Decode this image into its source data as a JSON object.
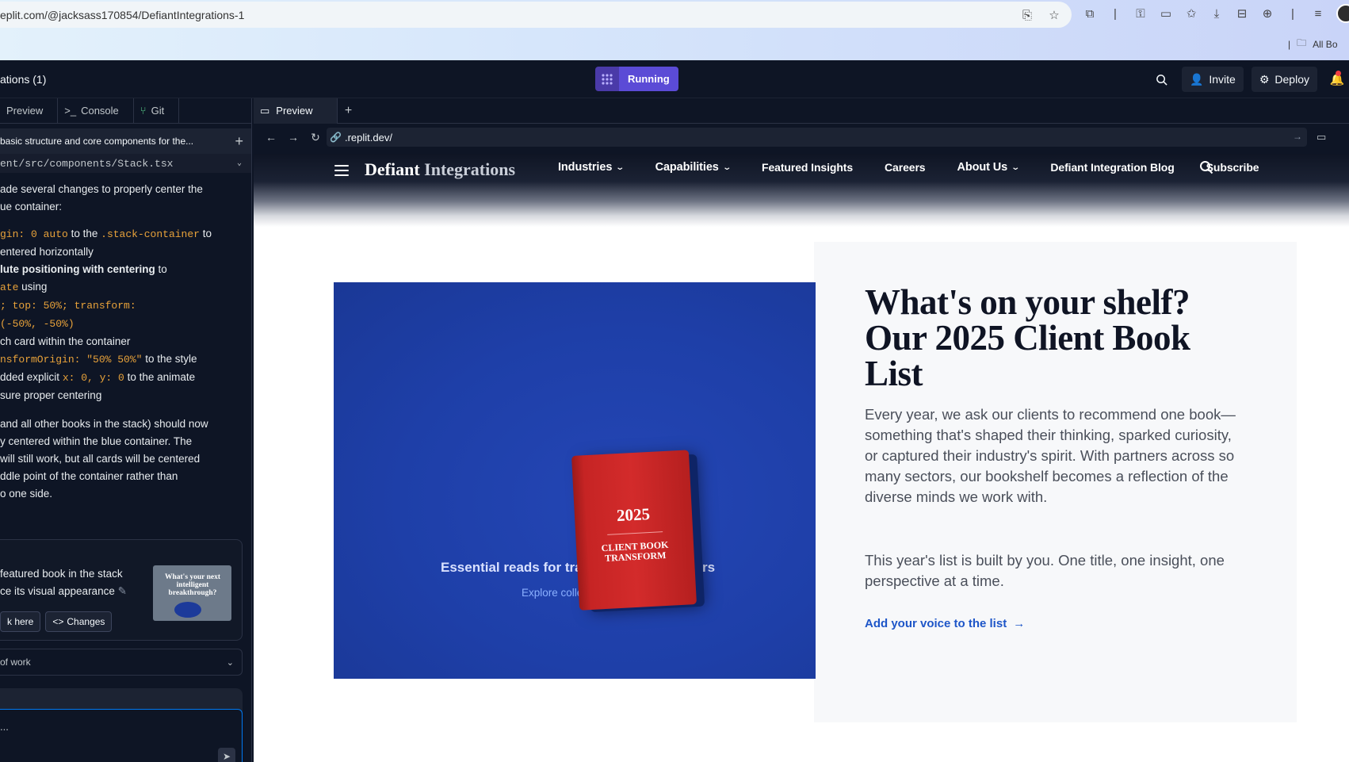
{
  "browser": {
    "url": "eplit.com/@jacksass170854/DefiantIntegrations-1",
    "bookmarks_label": "All Bo"
  },
  "replit": {
    "project_title": "ations (1)",
    "run_label": "Running",
    "invite_label": "Invite",
    "deploy_label": "Deploy"
  },
  "left_panel": {
    "tabs": [
      "Preview",
      "Console",
      "Git"
    ],
    "task_title": "basic structure and core components for the...",
    "file_path": "ent/src/components/Stack.tsx",
    "chat": {
      "p1": "ade several changes to properly center the",
      "p1b": "ue container:",
      "l1_code": "gin: 0 auto",
      "l1_mid": "to the",
      "l1_code2": ".stack-container",
      "l1_end": "to",
      "l2": "entered horizontally",
      "l3_bold": "lute positioning with centering",
      "l3_end": "to",
      "l4_code": "ate",
      "l4_end": "using",
      "l5_code": "; top: 50%; transform:",
      "l6_code": "(-50%, -50%)",
      "l7": "ch card within the container",
      "l8_code": "nsformOrigin: \"50% 50%\"",
      "l8_end": "to the style",
      "l9_start": "dded explicit",
      "l9_code": "x: 0, y: 0",
      "l9_end": "to the animate",
      "l10": "sure proper centering",
      "p2a": "and all other books in the stack) should now",
      "p2b": "y centered within the blue container. The",
      "p2c": "will still work, but all cards will be centered",
      "p2d": "ddle point of the container rather than",
      "p2e": "o one side."
    },
    "card": {
      "line1": "featured book in the stack",
      "line2": "ce its visual appearance",
      "thumb_text": "What's your next intelligent breakthrough?",
      "btn1": "k here",
      "btn2": "Changes"
    },
    "work_row": "of work",
    "input_placeholder": "..."
  },
  "preview": {
    "tab_label": "Preview",
    "address": ".replit.dev/"
  },
  "site": {
    "logo_main": "Defiant",
    "logo_light": "Integrations",
    "menu": [
      {
        "label": "Industries",
        "has_chevron": true
      },
      {
        "label": "Capabilities",
        "has_chevron": true
      },
      {
        "label": "Featured Insights",
        "has_chevron": false
      },
      {
        "label": "Careers",
        "has_chevron": false
      },
      {
        "label": "About Us",
        "has_chevron": true
      },
      {
        "label": "Defiant Integration Blog",
        "has_chevron": false
      },
      {
        "label": "Subscribe",
        "has_chevron": false
      }
    ],
    "hero": {
      "title_start": "Essential reads for tra",
      "title_end": "rs",
      "link": "Explore collection",
      "book_year": "2025",
      "book_sub": "CLIENT BOOK TRANSFORM"
    },
    "headline": "What's on your shelf? Our 2025 Client Book List",
    "body1": "Every year, we ask our clients to recommend one book—something that's shaped their thinking, sparked curiosity, or captured their industry's spirit. With partners across so many sectors, our bookshelf becomes a reflection of the diverse minds we work with.",
    "body2": "This year's list is built by you. One title, one insight, one perspective at a time.",
    "cta": "Add your voice to the list"
  },
  "colors": {
    "replit_bg": "#0e1525",
    "running": "#5b4bd6",
    "hero_blue": "#1e3fa8",
    "book_red": "#d32b2b",
    "cta_blue": "#1e56c8"
  }
}
